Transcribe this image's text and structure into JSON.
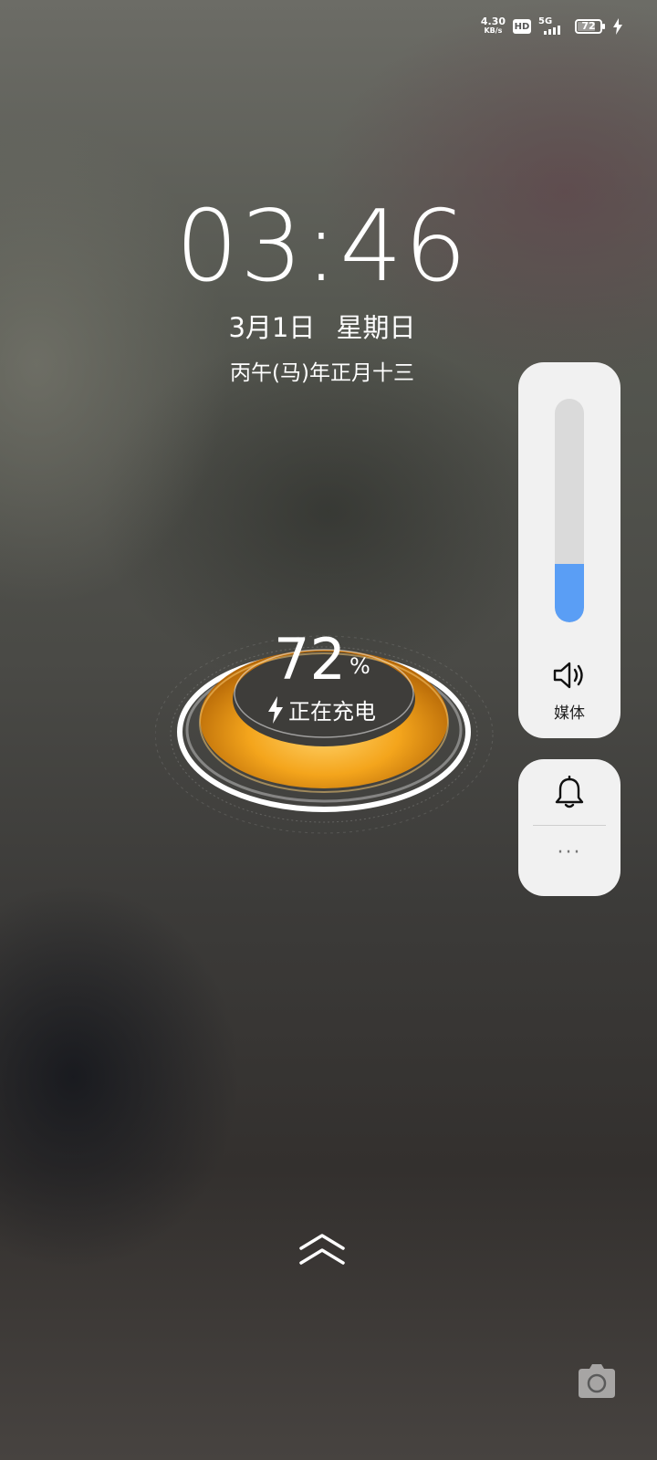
{
  "status_bar": {
    "net_speed_value": "4.30",
    "net_speed_unit": "KB/s",
    "hd_label": "HD",
    "network_label": "5G",
    "battery_level": "72",
    "charging_icon": "lightning-bolt-icon"
  },
  "clock": {
    "time": "03:46",
    "date": "3月1日 星期日",
    "lunar_date": "丙午(马)年正月十三"
  },
  "charging": {
    "percent": "72",
    "unit": "%",
    "status": "正在充电",
    "ring_color": "#f4a51c"
  },
  "volume_panel": {
    "level_percent": 26,
    "fill_color": "#5a9ef5",
    "icon": "speaker-icon",
    "label": "媒体"
  },
  "ringer_panel": {
    "icon": "bell-icon",
    "more_label": "···"
  },
  "bottom": {
    "swipe_icon": "double-chevron-up-icon",
    "camera_icon": "camera-icon"
  }
}
